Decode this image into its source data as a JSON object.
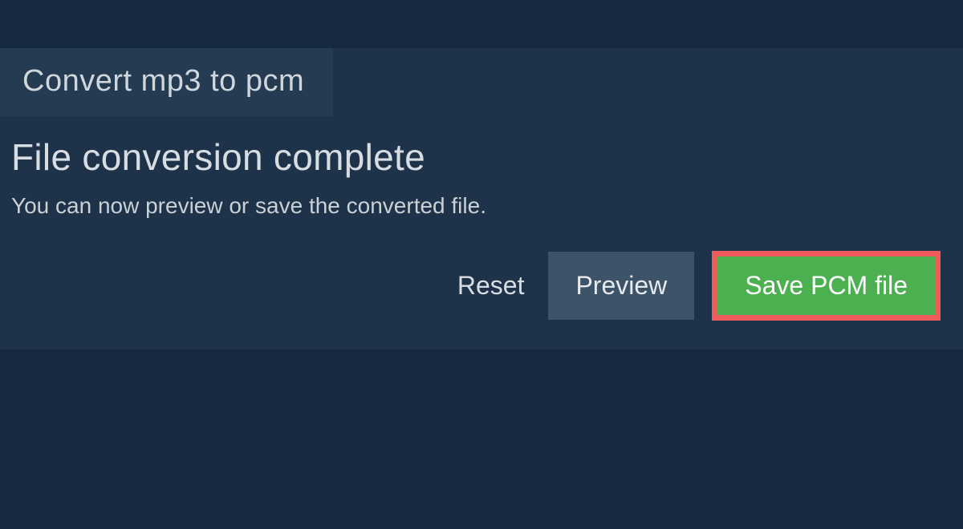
{
  "tab": {
    "label": "Convert mp3 to pcm"
  },
  "main": {
    "heading": "File conversion complete",
    "subtext": "You can now preview or save the converted file."
  },
  "actions": {
    "reset": "Reset",
    "preview": "Preview",
    "save": "Save PCM file"
  }
}
